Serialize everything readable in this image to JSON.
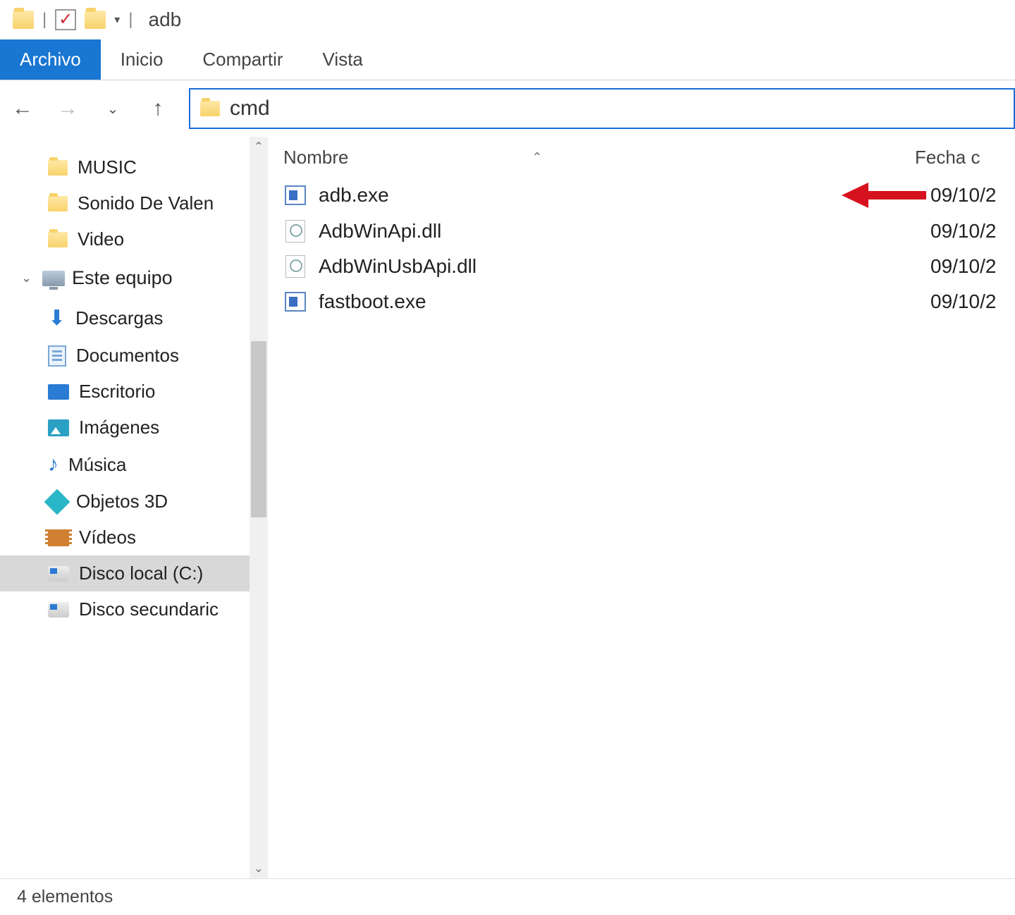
{
  "window": {
    "title": "adb"
  },
  "tabs": {
    "archivo": "Archivo",
    "inicio": "Inicio",
    "compartir": "Compartir",
    "vista": "Vista"
  },
  "address": {
    "text": "cmd"
  },
  "columns": {
    "name": "Nombre",
    "date": "Fecha c"
  },
  "sidebar": {
    "items": [
      {
        "label": "MUSIC",
        "icon": "folder"
      },
      {
        "label": "Sonido De Valen",
        "icon": "folder"
      },
      {
        "label": "Video",
        "icon": "folder"
      }
    ],
    "group": "Este equipo",
    "libs": [
      {
        "label": "Descargas",
        "icon": "download"
      },
      {
        "label": "Documentos",
        "icon": "doc"
      },
      {
        "label": "Escritorio",
        "icon": "desk"
      },
      {
        "label": "Imágenes",
        "icon": "pic"
      },
      {
        "label": "Música",
        "icon": "music"
      },
      {
        "label": "Objetos 3D",
        "icon": "obj3d"
      },
      {
        "label": "Vídeos",
        "icon": "vid"
      },
      {
        "label": "Disco local (C:)",
        "icon": "disk",
        "selected": true
      },
      {
        "label": "Disco secundaric",
        "icon": "disk"
      }
    ]
  },
  "files": [
    {
      "name": "adb.exe",
      "type": "exe",
      "date": "09/10/2",
      "highlighted": true
    },
    {
      "name": "AdbWinApi.dll",
      "type": "dll",
      "date": "09/10/2"
    },
    {
      "name": "AdbWinUsbApi.dll",
      "type": "dll",
      "date": "09/10/2"
    },
    {
      "name": "fastboot.exe",
      "type": "exe",
      "date": "09/10/2"
    }
  ],
  "status": {
    "count": "4 elementos"
  }
}
